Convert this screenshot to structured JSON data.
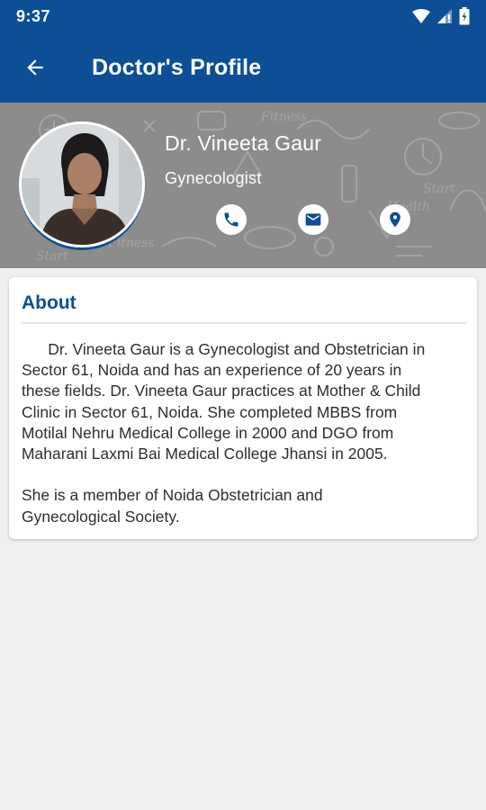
{
  "status_bar": {
    "time": "9:37"
  },
  "app_bar": {
    "title": "Doctor's Profile"
  },
  "doctor": {
    "name": "Dr. Vineeta Gaur",
    "specialty": "Gynecologist"
  },
  "about": {
    "title": "About",
    "text": "      Dr. Vineeta Gaur is a Gynecologist and Obstetrician in\nSector 61, Noida and has an experience of 20 years in\nthese fields. Dr. Vineeta Gaur practices at Mother & Child\nClinic in Sector 61, Noida. She completed MBBS from\nMotilal Nehru Medical College in 2000 and DGO from\nMaharani Laxmi Bai Medical College Jhansi in 2005.\n\nShe is a member of Noida Obstetrician and\nGynecological Society."
  },
  "colors": {
    "primary": "#0c4f96",
    "header_bg": "#8c8c8c",
    "page_bg": "#efefef"
  },
  "icons": {
    "back": "arrow-back-icon",
    "call": "phone-icon",
    "mail": "email-icon",
    "location": "location-pin-icon"
  }
}
